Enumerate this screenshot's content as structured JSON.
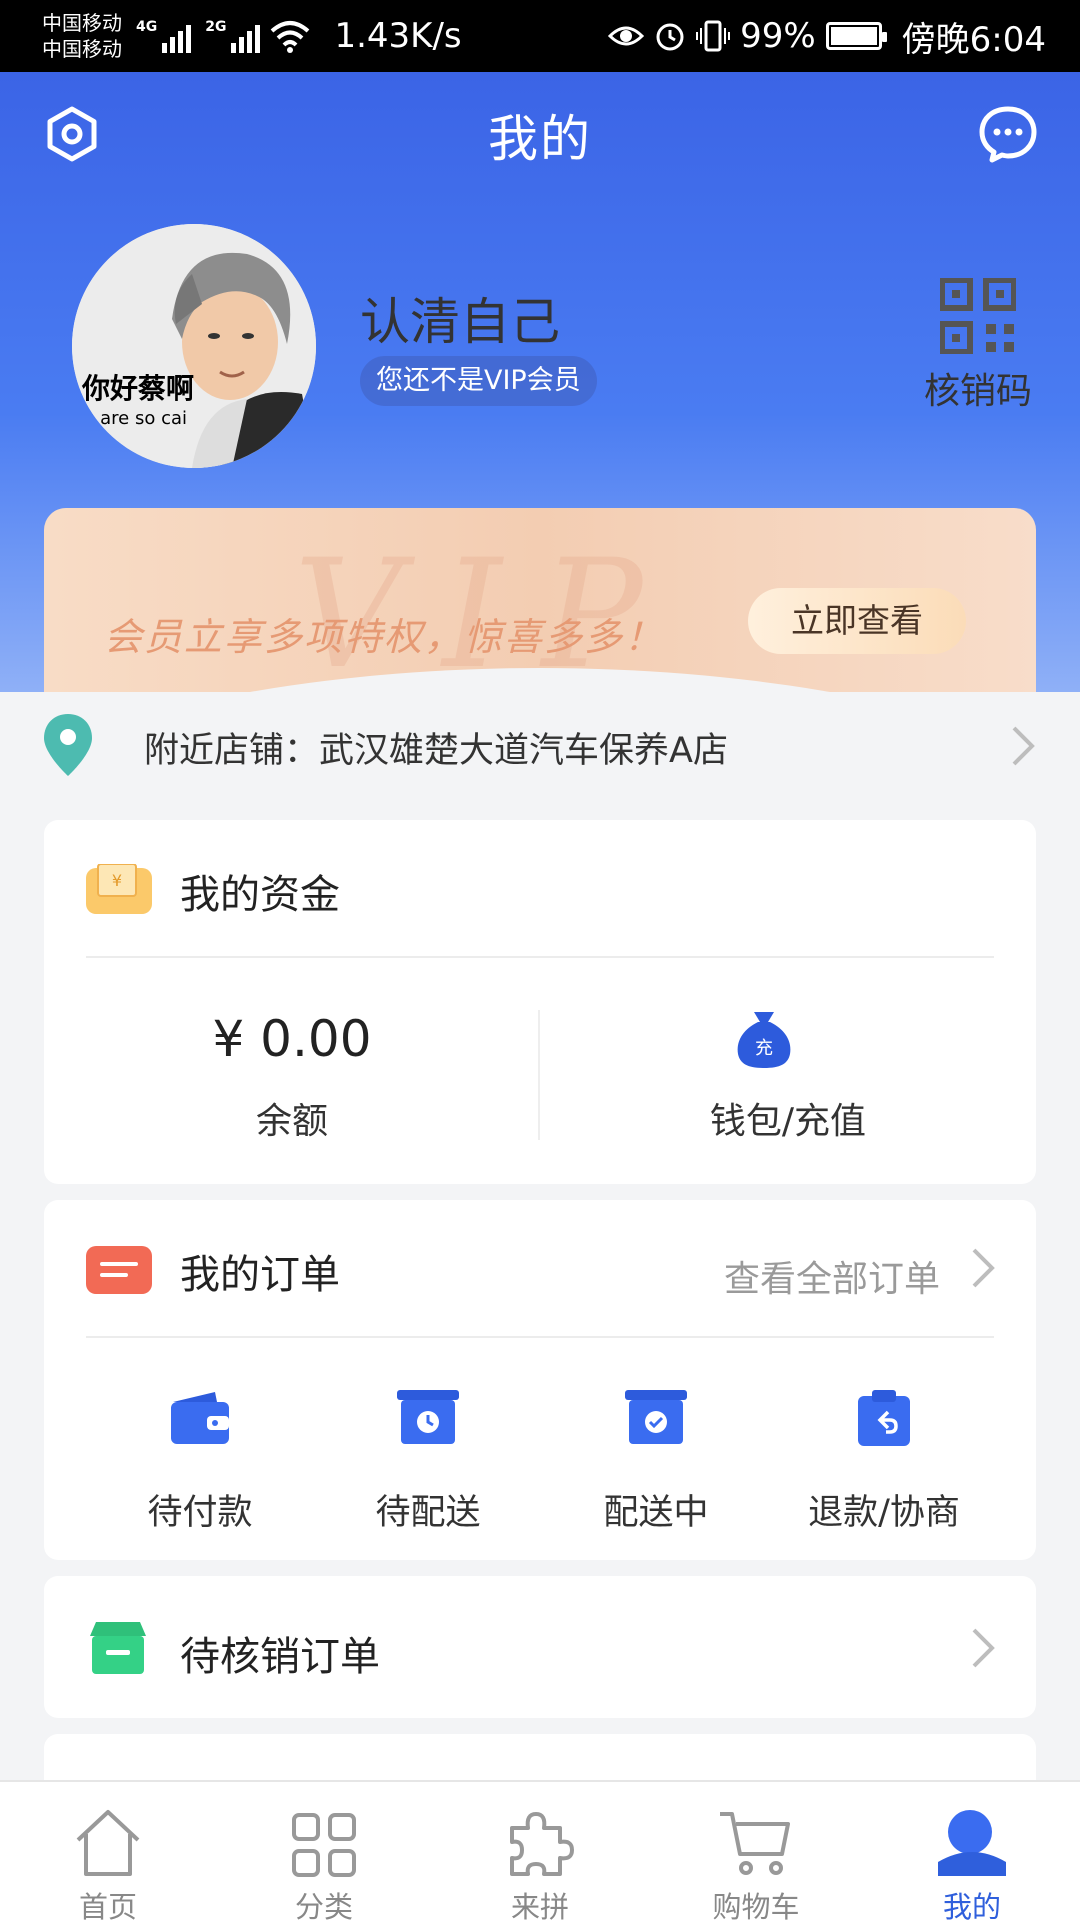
{
  "status_bar": {
    "carrier_1": "中国移动",
    "carrier_2": "中国移动",
    "net_1": "4G",
    "net_2": "2G",
    "speed": "1.43K/s",
    "battery": "99%",
    "time": "傍晚6:04"
  },
  "header": {
    "title": "我的",
    "settings_icon": "settings-hexagon-icon",
    "message_icon": "chat-bubble-icon"
  },
  "profile": {
    "avatar_caption": "你好蔡啊",
    "avatar_subcaption": "ou are so cai",
    "username": "认清自己",
    "vip_status": "您还不是VIP会员",
    "qr_label": "核销码"
  },
  "vip_banner": {
    "watermark": "VIP",
    "text": "会员立享多项特权，惊喜多多！",
    "button": "立即查看"
  },
  "nearby_store": {
    "label": "附近店铺：武汉雄楚大道汽车保养A店"
  },
  "funds": {
    "title": "我的资金",
    "balance_value": "¥ 0.00",
    "balance_label": "余额",
    "wallet_label": "钱包/充值",
    "wallet_icon_text": "充"
  },
  "orders": {
    "title": "我的订单",
    "view_all": "查看全部订单",
    "items": [
      {
        "label": "待付款",
        "icon": "wallet-icon"
      },
      {
        "label": "待配送",
        "icon": "box-clock-icon"
      },
      {
        "label": "配送中",
        "icon": "box-check-icon"
      },
      {
        "label": "退款/协商",
        "icon": "clipboard-return-icon"
      }
    ]
  },
  "verify_orders": {
    "title": "待核销订单"
  },
  "bottom_nav": {
    "items": [
      {
        "label": "首页",
        "icon": "home-icon"
      },
      {
        "label": "分类",
        "icon": "grid-icon"
      },
      {
        "label": "来拼",
        "icon": "puzzle-icon"
      },
      {
        "label": "购物车",
        "icon": "cart-icon"
      },
      {
        "label": "我的",
        "icon": "user-icon",
        "active": true
      }
    ]
  },
  "colors": {
    "brand_blue": "#3b64e6",
    "active_nav": "#2f5fdc",
    "vip_text": "#e69a74"
  }
}
